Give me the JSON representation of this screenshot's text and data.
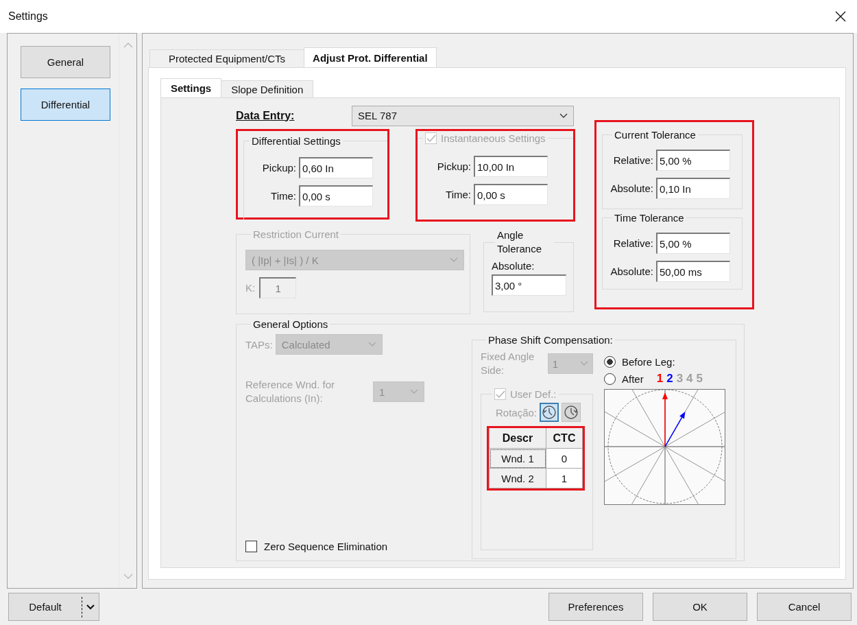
{
  "window": {
    "title": "Settings"
  },
  "sidebar": {
    "items": [
      {
        "label": "General",
        "selected": false
      },
      {
        "label": "Differential",
        "selected": true
      }
    ]
  },
  "tabs": [
    {
      "label": "Protected Equipment/CTs",
      "selected": false
    },
    {
      "label": "Adjust Prot. Differential",
      "selected": true
    }
  ],
  "subtabs": [
    {
      "label": "Settings",
      "selected": true
    },
    {
      "label": "Slope Definition",
      "selected": false
    }
  ],
  "data_entry": {
    "label": "Data Entry:",
    "value": "SEL 787"
  },
  "differential_settings": {
    "title": "Differential Settings",
    "highlighted": true,
    "fields": [
      {
        "label": "Pickup:",
        "value": "0,60 In"
      },
      {
        "label": "Time:",
        "value": "0,00 s"
      }
    ]
  },
  "instantaneous_settings": {
    "title": "Instantaneous Settings",
    "checked": true,
    "disabled": true,
    "highlighted": true,
    "fields": [
      {
        "label": "Pickup:",
        "value": "10,00 In"
      },
      {
        "label": "Time:",
        "value": "0,00 s"
      }
    ]
  },
  "tolerances": {
    "highlighted": true,
    "groups": [
      {
        "title": "Current Tolerance",
        "fields": [
          {
            "label": "Relative:",
            "value": "5,00 %"
          },
          {
            "label": "Absolute:",
            "value": "0,10 In"
          }
        ]
      },
      {
        "title": "Time Tolerance",
        "fields": [
          {
            "label": "Relative:",
            "value": "5,00 %"
          },
          {
            "label": "Absolute:",
            "value": "50,00 ms"
          }
        ]
      }
    ]
  },
  "restriction_current": {
    "title": "Restriction Current",
    "disabled": true,
    "formula": "( |Ip| + |Is| ) / K",
    "k_label": "K:",
    "k_value": "1"
  },
  "angle_tolerance": {
    "title": "Angle Tolerance",
    "field_label": "Absolute:",
    "value": "3,00 °"
  },
  "general_options": {
    "title": "General Options",
    "taps": {
      "label": "TAPs:",
      "value": "Calculated",
      "disabled": true
    },
    "reference": {
      "label": "Reference Wnd. for Calculations (In):",
      "value": "1",
      "disabled": true
    },
    "zero_sequence": {
      "label": "Zero Sequence Elimination",
      "checked": false
    }
  },
  "phase_shift": {
    "title": "Phase Shift Compensation:",
    "fixed_angle": {
      "label": "Fixed Angle Side:",
      "value": "1",
      "disabled": true
    },
    "options": [
      {
        "label": "Before Leg:",
        "selected": true
      },
      {
        "label": "After",
        "selected": false
      }
    ],
    "legs": [
      {
        "label": "1",
        "color": "#ff0000"
      },
      {
        "label": "2",
        "color": "#0000ff"
      },
      {
        "label": "3",
        "color": "#a0a0a0"
      },
      {
        "label": "4",
        "color": "#a0a0a0"
      },
      {
        "label": "5",
        "color": "#a0a0a0"
      }
    ],
    "user_def": {
      "label": "User Def.:",
      "checked": true,
      "disabled": true,
      "rotation_label": "Rotação:",
      "rotations": [
        {
          "selected": true
        },
        {
          "selected": false
        }
      ],
      "table": {
        "highlighted": true,
        "columns": [
          "Descr",
          "CTC"
        ],
        "rows": [
          [
            "Wnd. 1",
            "0"
          ],
          [
            "Wnd. 2",
            "1"
          ]
        ]
      }
    }
  },
  "buttons": {
    "default": "Default",
    "actions": [
      "Preferences",
      "OK",
      "Cancel"
    ]
  }
}
